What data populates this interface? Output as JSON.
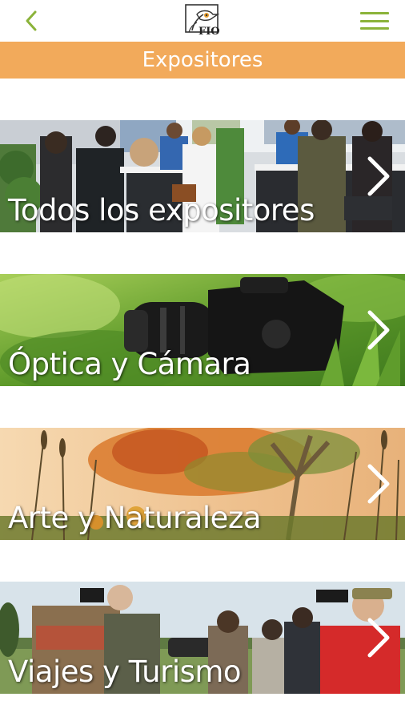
{
  "header": {
    "back_icon": "chevron-left-icon",
    "logo_text": "FIO",
    "menu_icon": "hamburger-icon",
    "accent_color": "#8bb33a"
  },
  "page": {
    "title": "Expositores",
    "title_bar_color": "#f2aa5b"
  },
  "categories": [
    {
      "label": "Todos los expositores",
      "icon": "chevron-right-icon"
    },
    {
      "label": "Óptica y Cámara",
      "icon": "chevron-right-icon"
    },
    {
      "label": "Arte y Naturaleza",
      "icon": "chevron-right-icon"
    },
    {
      "label": "Viajes y Turismo",
      "icon": "chevron-right-icon"
    }
  ]
}
